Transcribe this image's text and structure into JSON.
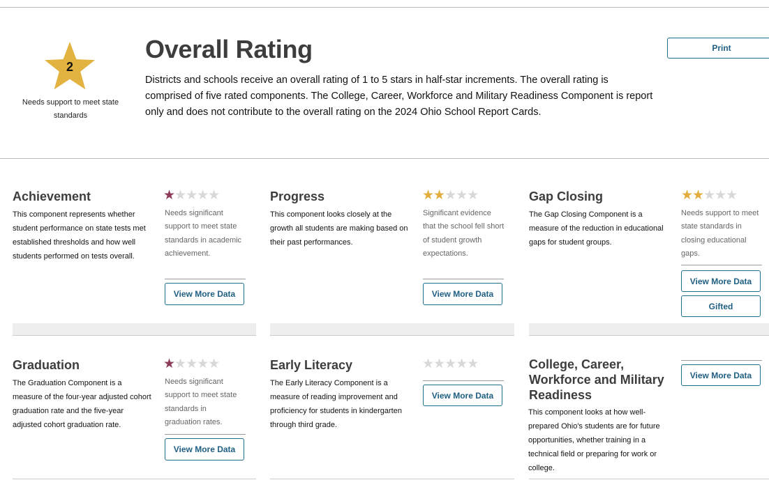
{
  "header": {
    "rating_value": "2",
    "star_color": "#e3b341",
    "star_caption": "Needs support to meet state standards",
    "title": "Overall Rating",
    "description": "Districts and schools receive an overall rating of 1 to 5 stars in half-star increments. The overall rating is comprised of five rated components. The College, Career, Workforce and Military Readiness Component is report only and does not contribute to the overall rating on the 2024 Ohio School Report Cards.",
    "print_label": "Print"
  },
  "colors": {
    "button_border": "#1f6f8f",
    "button_text": "#1f5f83",
    "star_low": "#8c3a5a",
    "star_gold": "#e3ad3b",
    "star_empty": "#d8d8d8"
  },
  "components": [
    {
      "title": "Achievement",
      "description": "This component represents whether student performance on state tests met established thresholds and how well students performed on tests overall.",
      "stars": 1,
      "star_color": "red",
      "rating_text": "Needs significant support to meet state standards in academic achievement.",
      "buttons": [
        "View More Data"
      ]
    },
    {
      "title": "Progress",
      "description": "This component looks closely at the growth all students are making based on their past performances.",
      "stars": 2,
      "star_color": "gold",
      "rating_text": "Significant evidence that the school fell short of student growth expectations.",
      "buttons": [
        "View More Data"
      ]
    },
    {
      "title": "Gap Closing",
      "description": "The Gap Closing Component is a measure of the reduction in educational gaps for student groups.",
      "stars": 2,
      "star_color": "gold",
      "rating_text": "Needs support to meet state standards in closing educational gaps.",
      "buttons": [
        "View More Data",
        "Gifted"
      ]
    },
    {
      "title": "Graduation",
      "description": "The Graduation Component is a measure of the four-year adjusted cohort graduation rate and the five-year adjusted cohort graduation rate.",
      "stars": 1,
      "star_color": "red",
      "rating_text": "Needs significant support to meet state standards in graduation rates.",
      "buttons": [
        "View More Data"
      ]
    },
    {
      "title": "Early Literacy",
      "description": "The Early Literacy Component is a measure of reading improvement and proficiency for students in kindergarten through third grade.",
      "stars": 0,
      "star_color": "empty",
      "rating_text": "",
      "buttons": [
        "View More Data"
      ]
    },
    {
      "title": "College, Career, Workforce and Military Readiness",
      "description": "This component looks at how well-prepared Ohio's students are for future opportunities, whether training in a technical field or preparing for work or college.",
      "stars": null,
      "rating_text": "",
      "buttons": [
        "View More Data"
      ]
    }
  ]
}
